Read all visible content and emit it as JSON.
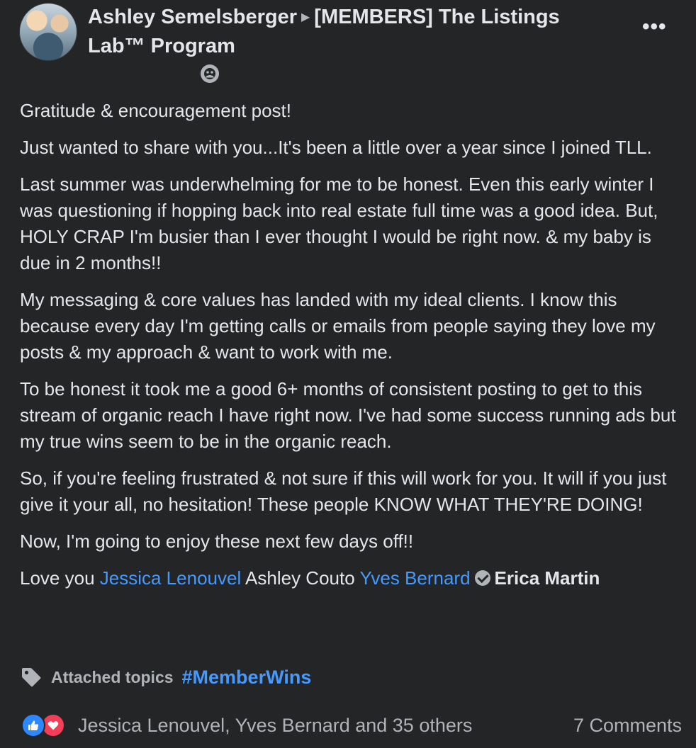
{
  "header": {
    "author": "Ashley Semelsberger",
    "group": "[MEMBERS] The Listings Lab™ Program"
  },
  "icons": {
    "avatar": "profile-photo",
    "separator": "caret-right-icon",
    "more": "more-options-icon",
    "privacy": "group-members-icon",
    "topic": "tag-icon",
    "verified": "verified-badge-icon",
    "reaction_like": "like-icon",
    "reaction_love": "love-icon"
  },
  "post": {
    "p1": "Gratitude & encouragement post!",
    "p2": "Just wanted to share with you...It's been a little over a year since I joined TLL.",
    "p3": "Last summer was underwhelming for me to be honest. Even this early winter I was questioning if hopping back into real estate full time was a good idea. But, HOLY CRAP I'm busier than I ever thought I would be right now.  & my baby is due in 2 months!!",
    "p4": "My messaging & core values has landed with my ideal clients. I know this because every day I'm getting calls or emails from people saying they love my posts & my approach & want to work with me.",
    "p5": "To be honest it took me a good 6+ months of consistent posting to get to this stream of organic reach I have right now. I've had some success running ads but my true wins seem to be in the organic reach.",
    "p6": "So, if you're feeling frustrated & not sure if this will work for you. It will if you just give it your all, no hesitation! These people KNOW WHAT THEY'RE DOING!",
    "p7": "Now, I'm going to enjoy these next few days off!!",
    "love_prefix": "Love you",
    "mentions": [
      "Jessica Lenouvel",
      "Ashley Couto",
      "Yves Bernard",
      "Erica Martin"
    ]
  },
  "topics": {
    "label": "Attached topics",
    "tag": "#MemberWins"
  },
  "footer": {
    "reactors": "Jessica Lenouvel, Yves Bernard and 35 others",
    "comments": "7 Comments"
  },
  "colors": {
    "background": "#242526",
    "text": "#e4e6eb",
    "secondary": "#b0b3b8",
    "link": "#4599ff",
    "like": "#2d88ff",
    "love": "#f33e58"
  }
}
